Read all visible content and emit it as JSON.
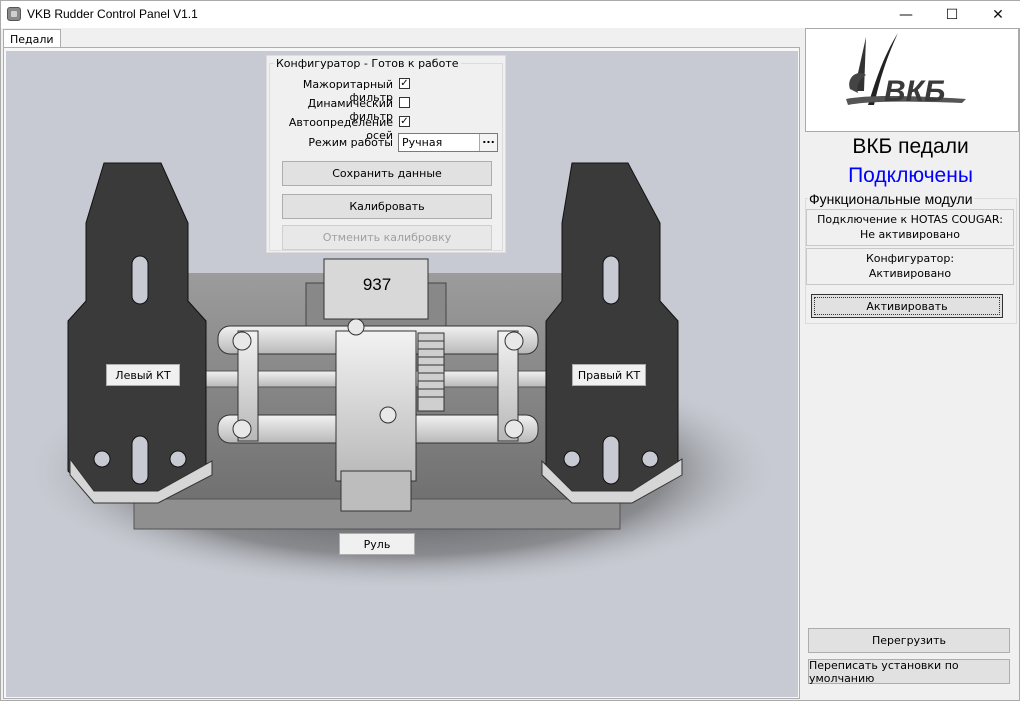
{
  "window": {
    "title": "VKB Rudder Control Panel V1.1",
    "minimize": "—",
    "maximize": "☐",
    "close": "✕"
  },
  "tabs": [
    {
      "label": "Педали"
    }
  ],
  "configurator": {
    "legend": "Конфигуратор - Готов к работе",
    "majority_filter": {
      "label": "Мажоритарный фильтр",
      "checked": true
    },
    "dynamic_filter": {
      "label": "Динамический фильтр",
      "checked": false
    },
    "auto_axes": {
      "label": "Автоопределение осей",
      "checked": true
    },
    "mode_label": "Режим работы",
    "mode_value": "Ручная",
    "mode_button": "...",
    "save_button": "Сохранить данные",
    "calibrate_button": "Калибровать",
    "cancel_calibration_button": "Отменить калибровку"
  },
  "scene": {
    "axis_value": "937",
    "left_kt": "Левый КТ",
    "right_kt": "Правый КТ",
    "rudder": "Руль"
  },
  "side": {
    "logo_text": "ВКБ",
    "device_name": "ВКБ педали",
    "status": "Подключены",
    "status_color": "#0000ff",
    "modules_legend": "Функциональные модули",
    "hotas_module_title": "Подключение к HOTAS COUGAR:",
    "hotas_module_state": "Не активировано",
    "config_module_title": "Конфигуратор:",
    "config_module_state": "Активировано",
    "activate_button": "Активировать",
    "reload_button": "Перегрузить",
    "reset_defaults_button": "Переписать установки по умолчанию"
  }
}
